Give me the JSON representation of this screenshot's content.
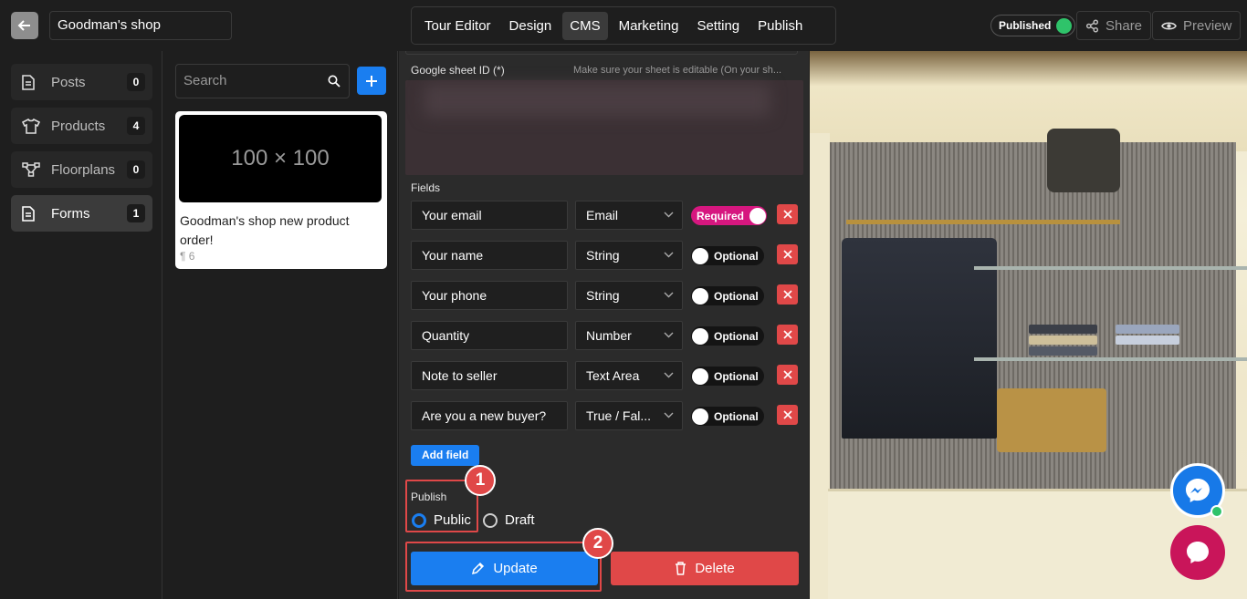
{
  "header": {
    "back_icon": "arrow-left-icon",
    "project_name": "Goodman's shop",
    "tabs": [
      "Tour Editor",
      "Design",
      "CMS",
      "Marketing",
      "Setting",
      "Publish"
    ],
    "active_tab": "CMS",
    "status": "Published",
    "status_color": "#2fc36a",
    "share_label": "Share",
    "preview_label": "Preview"
  },
  "sidebar": {
    "items": [
      {
        "label": "Posts",
        "count": "0",
        "icon": "document-icon"
      },
      {
        "label": "Products",
        "count": "4",
        "icon": "tshirt-icon"
      },
      {
        "label": "Floorplans",
        "count": "0",
        "icon": "floorplan-icon"
      },
      {
        "label": "Forms",
        "count": "1",
        "icon": "form-icon"
      }
    ],
    "active": "Forms"
  },
  "list": {
    "search_placeholder": "Search",
    "card": {
      "thumbnail_text": "100 × 100",
      "title": "Goodman's shop new product order!",
      "meta": "¶ 6"
    }
  },
  "editor": {
    "sheet_label": "Google sheet ID (*)",
    "sheet_hint": "Make sure your sheet is editable (On your sh...",
    "fields_label": "Fields",
    "fields": [
      {
        "name": "Your email",
        "type": "Email",
        "toggle": "Required",
        "on": true
      },
      {
        "name": "Your name",
        "type": "String",
        "toggle": "Optional",
        "on": false
      },
      {
        "name": "Your phone",
        "type": "String",
        "toggle": "Optional",
        "on": false
      },
      {
        "name": "Quantity",
        "type": "Number",
        "toggle": "Optional",
        "on": false
      },
      {
        "name": "Note to seller",
        "type": "Text Area",
        "toggle": "Optional",
        "on": false
      },
      {
        "name": "Are you a new buyer?",
        "type": "True / Fal...",
        "toggle": "Optional",
        "on": false
      }
    ],
    "add_field_label": "Add field",
    "publish_label": "Publish",
    "publish_options": [
      "Public",
      "Draft"
    ],
    "publish_selected": "Public",
    "update_label": "Update",
    "delete_label": "Delete",
    "annotations": [
      "1",
      "2"
    ],
    "colors": {
      "primary": "#1a7ef0",
      "danger": "#e04848",
      "required": "#d6177f"
    }
  }
}
